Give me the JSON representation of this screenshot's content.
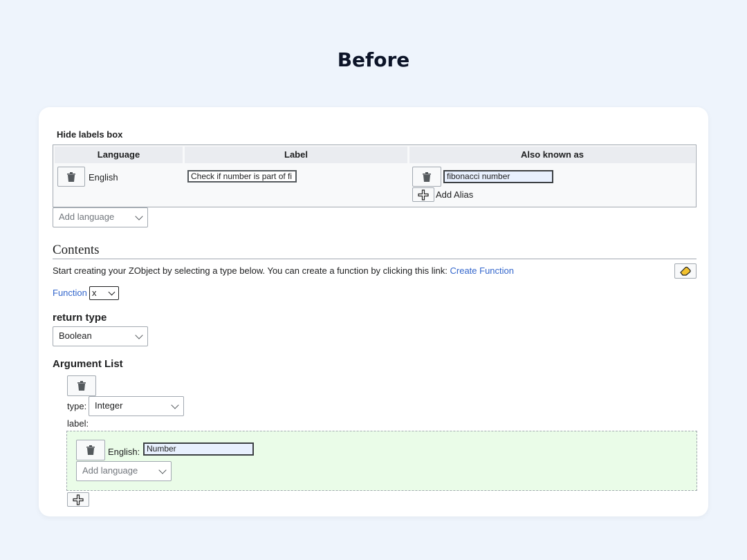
{
  "heading": "Before",
  "labels_box": {
    "toggle": "Hide labels box",
    "columns": [
      "Language",
      "Label",
      "Also known as"
    ],
    "row": {
      "language": "English",
      "label_value": "Check if number is part of fi",
      "alias_value": "fibonacci number",
      "add_alias": "Add Alias"
    },
    "add_language_placeholder": "Add language"
  },
  "contents": {
    "title": "Contents",
    "intro": "Start creating your ZObject by selecting a type below. You can create a function by clicking this link:",
    "intro_link": "Create Function",
    "function_link": "Function",
    "function_select": "x",
    "return_type_label": "return type",
    "return_type_value": "Boolean",
    "argument_list_label": "Argument List",
    "argument": {
      "type_label": "type:",
      "type_value": "Integer",
      "label_label": "label:",
      "lang_label": "English:",
      "lang_value": "Number",
      "add_language_placeholder": "Add language"
    }
  },
  "icons": {
    "trash": "trash-icon",
    "plus": "plus-icon",
    "eraser": "eraser-icon",
    "chevron": "chevron-down-icon"
  },
  "colors": {
    "link": "#3366cc",
    "page_bg": "#eef4fc",
    "argument_bg": "#eafce8"
  }
}
